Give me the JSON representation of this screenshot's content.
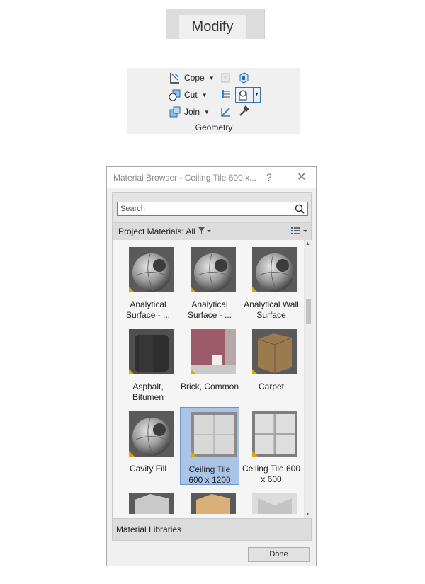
{
  "ribbon_tab": {
    "label": "Modify"
  },
  "geometry_panel": {
    "title": "Geometry",
    "tools": [
      {
        "label": "Cope",
        "icon": "cope-icon"
      },
      {
        "label": "Cut",
        "icon": "cut-icon"
      },
      {
        "label": "Join",
        "icon": "join-icon"
      }
    ]
  },
  "material_browser": {
    "title": "Material Browser - Ceiling Tile 600 x...",
    "help": "?",
    "close": "✕",
    "search_placeholder": "Search",
    "project_materials_label": "Project Materials: All",
    "footer_label": "Material Libraries",
    "done_label": "Done",
    "materials": [
      {
        "name": "Analytical Surface - ...",
        "kind": "sphere",
        "selected": false
      },
      {
        "name": "Analytical Surface - ...",
        "kind": "sphere",
        "selected": false
      },
      {
        "name": "Analytical Wall Surface",
        "kind": "sphere",
        "selected": false
      },
      {
        "name": "Asphalt, Bitumen",
        "kind": "asphalt",
        "selected": false
      },
      {
        "name": "Brick, Common",
        "kind": "brick",
        "selected": false
      },
      {
        "name": "Carpet",
        "kind": "carpet",
        "selected": false
      },
      {
        "name": "Cavity Fill",
        "kind": "sphere",
        "selected": false
      },
      {
        "name": "Ceiling Tile 600 x 1200",
        "kind": "tile",
        "selected": true
      },
      {
        "name": "Ceiling Tile 600 x 600",
        "kind": "tile2",
        "selected": false
      }
    ]
  }
}
